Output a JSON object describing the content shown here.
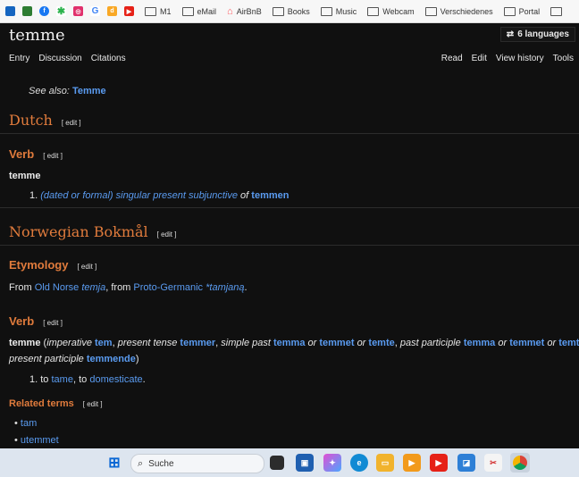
{
  "bookmarks": {
    "items": [
      "M1",
      "eMail",
      "AirBnB",
      "Books",
      "Music",
      "Webcam",
      "Verschiedenes",
      "Portal"
    ]
  },
  "header": {
    "title": "temme",
    "languages": "6 languages",
    "tabs": [
      "Entry",
      "Discussion",
      "Citations"
    ],
    "actions": [
      "Read",
      "Edit",
      "View history",
      "Tools"
    ]
  },
  "main": {
    "see_also_label": "See also:",
    "see_also_link": "Temme",
    "edit_label": "[ edit ]",
    "dutch": {
      "heading": "Dutch",
      "verb_heading": "Verb",
      "headword": "temme",
      "def_num": "1.",
      "def_qualifier": "(dated or formal)",
      "def_text": "singular present subjunctive",
      "def_of": "of",
      "def_target": "temmen"
    },
    "norwegian": {
      "heading": "Norwegian Bokmål",
      "etym_heading": "Etymology",
      "etym_from": "From",
      "etym_lang1": "Old Norse",
      "etym_word1": "temja",
      "etym_comma": ", from",
      "etym_lang2": "Proto-Germanic",
      "etym_word2": "*tamjaną",
      "verb_heading": "Verb",
      "headword": "temme",
      "forms": {
        "imperative_label": "imperative",
        "imperative": "tem",
        "present_label": "present tense",
        "present": "temmer",
        "past_label": "simple past",
        "past1": "temma",
        "or": "or",
        "past2": "temmet",
        "past3": "temte",
        "pp_label": "past participle",
        "pp1": "temma",
        "pp2": "temmet",
        "pp3": "temt",
        "prespart_label": "present participle",
        "prespart": "temmende"
      },
      "def_num": "1.",
      "def_to1": "to",
      "def_link1": "tame",
      "def_to2": ", to",
      "def_link2": "domesticate",
      "related_heading": "Related terms",
      "related": [
        "tam",
        "utemmet"
      ]
    }
  },
  "taskbar": {
    "search_placeholder": "Suche"
  }
}
